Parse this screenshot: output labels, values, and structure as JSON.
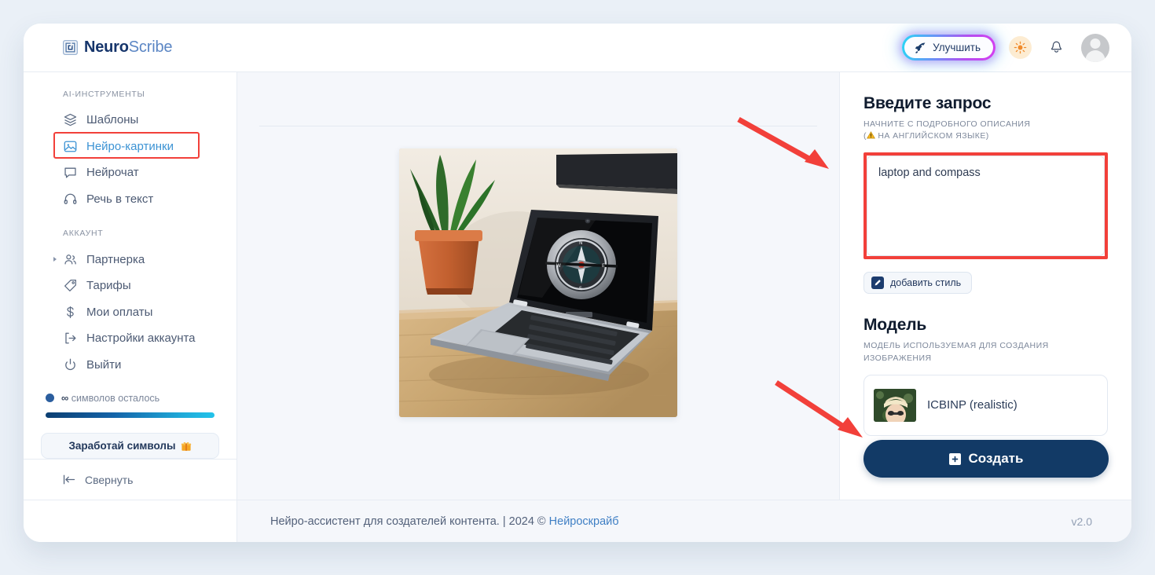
{
  "brand": {
    "strong": "Neuro",
    "soft": "Scribe",
    "logo_icon": "spiral-square-logo"
  },
  "header": {
    "upgrade_label": "Улучшить",
    "upgrade_icon": "rocket-icon",
    "theme_icon": "sun-icon",
    "bell_icon": "bell-icon",
    "avatar_icon": "user-avatar"
  },
  "sidebar": {
    "section_tools_caption": "AI-ИНСТРУМЕНТЫ",
    "section_account_caption": "АККАУНТ",
    "tools": [
      {
        "label": "Шаблоны",
        "icon": "layers-icon",
        "active": false,
        "highlight": false
      },
      {
        "label": "Нейро-картинки",
        "icon": "image-icon",
        "active": true,
        "highlight": true
      },
      {
        "label": "Нейрочат",
        "icon": "chat-bubble-icon",
        "active": false,
        "highlight": false
      },
      {
        "label": "Речь в текст",
        "icon": "headphones-icon",
        "active": false,
        "highlight": false
      }
    ],
    "account": [
      {
        "label": "Партнерка",
        "icon": "users-icon",
        "caret": true
      },
      {
        "label": "Тарифы",
        "icon": "tag-icon",
        "caret": false
      },
      {
        "label": "Мои оплаты",
        "icon": "dollar-icon",
        "caret": false
      },
      {
        "label": "Настройки аккаунта",
        "icon": "logout-bracket-icon",
        "caret": false
      },
      {
        "label": "Выйти",
        "icon": "power-icon",
        "caret": false
      }
    ],
    "quota_symbol": "∞",
    "quota_label": "символов осталось",
    "quota_progress_percent": 100,
    "earn_label": "Заработай символы",
    "earn_icon": "gift-icon",
    "collapse_label": "Свернуть",
    "collapse_icon": "collapse-left-icon"
  },
  "center": {
    "generated_image_alt": "laptop on wooden desk with compass on screen and a potted plant"
  },
  "prompt_panel": {
    "title": "Введите запрос",
    "subtitle_line1": "НАЧНИТЕ С ПОДРОБНОГО ОПИСАНИЯ",
    "subtitle_line2_prefix": "(",
    "subtitle_line2": " НА АНГЛИЙСКОМ ЯЗЫКЕ)",
    "subtitle_warning_icon": "warning-triangle-icon",
    "textarea_value": "laptop and compass",
    "textarea_placeholder": "",
    "add_style_label": "добавить стиль",
    "add_style_icon": "pencil-square-icon"
  },
  "model_panel": {
    "title": "Модель",
    "subtitle": "МОДЕЛЬ ИСПОЛЬЗУЕМАЯ ДЛЯ СОЗДАНИЯ ИЗОБРАЖЕНИЯ",
    "selected_model": "ICBINP (realistic)",
    "thumbnail_alt": "blonde person portrait thumbnail"
  },
  "create_button": {
    "label": "Создать",
    "icon": "plus-square-icon"
  },
  "footer": {
    "text": "Нейро-ассистент для создателей контента.",
    "separator": "|",
    "copyright": "2024 ©",
    "brand_link": "Нейроскрайб",
    "version": "v2.0"
  },
  "annotations": {
    "arrow_color": "#f2403a",
    "arrow_1_target": "prompt-textarea",
    "arrow_2_target": "create-button",
    "highlight_boxes": [
      "sidebar-item-neuro-images",
      "prompt-textarea"
    ]
  },
  "colors": {
    "brand_dark": "#16356b",
    "brand_light": "#5b86c4",
    "accent_active": "#3c93d4",
    "annotation_red": "#f2403a",
    "create_button": "#123a66",
    "page_bg": "#eaf0f7"
  }
}
